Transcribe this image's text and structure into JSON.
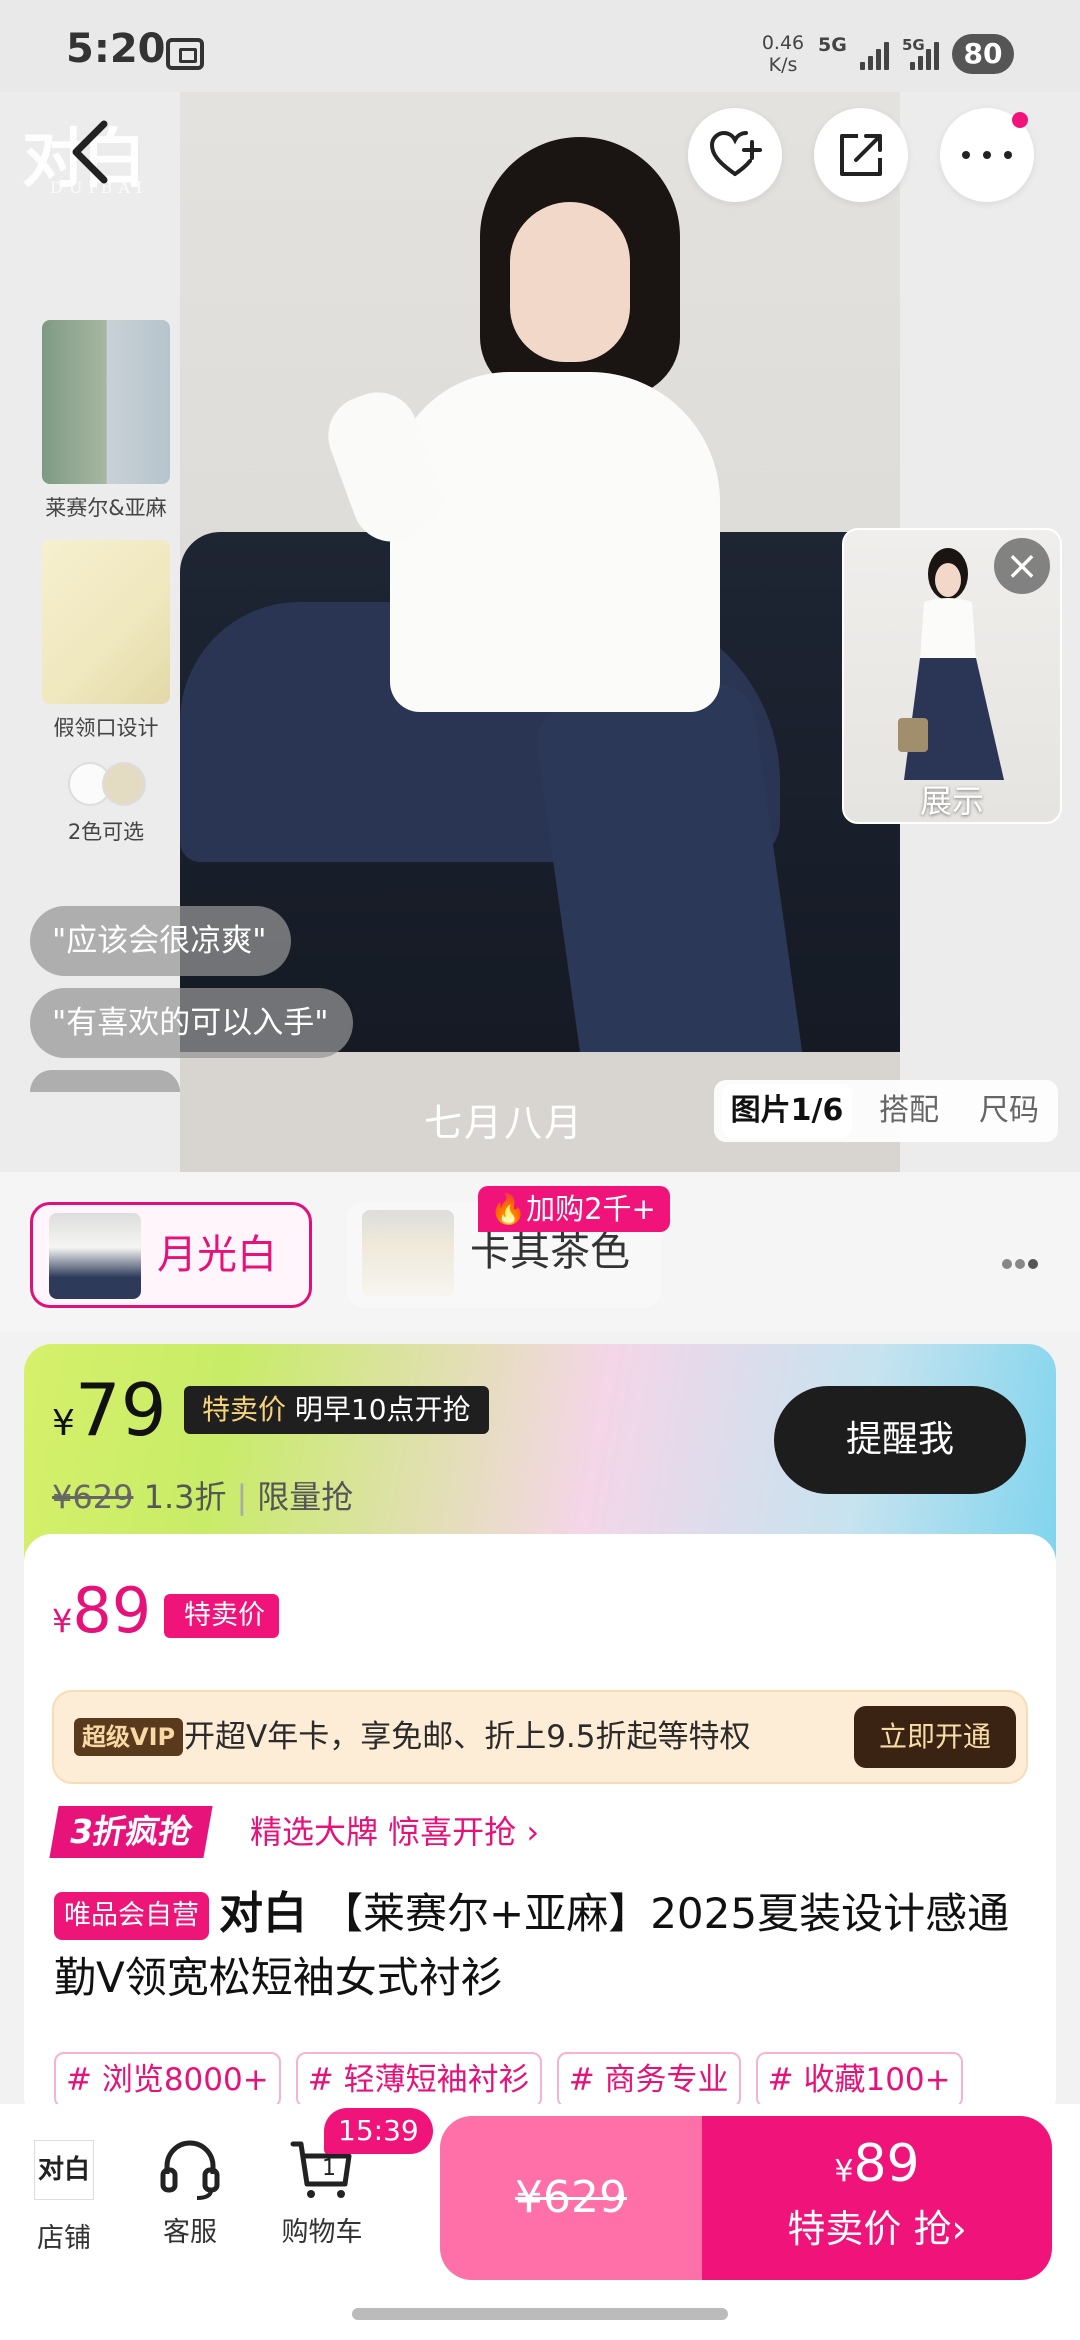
{
  "status_bar": {
    "time": "5:20",
    "speed_value": "0.46",
    "speed_unit": "K/s",
    "net1": "5G",
    "net2": "5G",
    "battery": "80"
  },
  "brand": {
    "logo_text": "对白",
    "logo_sub": "DUIBAI"
  },
  "hero": {
    "caption": "七月八月",
    "features": [
      {
        "label": "莱赛尔&亚麻"
      },
      {
        "label": "假领口设计"
      }
    ],
    "swatch_label": "2色可选",
    "bubbles": [
      "\"应该会很凉爽\"",
      "\"有喜欢的可以入手\""
    ],
    "float_video_label": "展示",
    "image_tabs": [
      "图片1/6",
      "搭配",
      "尺码"
    ]
  },
  "colors": {
    "options": [
      {
        "name": "月光白",
        "selected": true
      },
      {
        "name": "卡其茶色",
        "selected": false
      }
    ],
    "hot_badge": "加购2千+"
  },
  "promo": {
    "currency": "¥",
    "price": "79",
    "tag_label": "特卖价",
    "tag_time": "明早10点开抢",
    "original_price": "¥629",
    "discount": "1.3折",
    "limit": "限量抢",
    "remind_label": "提醒我"
  },
  "current": {
    "currency": "¥",
    "price": "89",
    "tag": "特卖价"
  },
  "vip": {
    "badge": "超级VIP",
    "text": "开超V年卡，享免邮、折上9.5折起等特权",
    "button": "立即开通"
  },
  "deal": {
    "badge": "3折疯抢",
    "text": "精选大牌 惊喜开抢 ›"
  },
  "product": {
    "self_badge": "唯品会自营",
    "brand": "对白",
    "title": "【莱赛尔+亚麻】2025夏装设计感通勤V领宽松短袖女式衬衫"
  },
  "tags": [
    "# 浏览8000+",
    "# 轻薄短袖衬衫",
    "# 商务专业",
    "# 收藏100+"
  ],
  "bottom": {
    "shop_label": "店铺",
    "shop_logo": "对白",
    "service_label": "客服",
    "cart_label": "购物车",
    "cart_count": "1",
    "timer": "15:39",
    "orig_price": "¥629",
    "buy_currency": "¥",
    "buy_price": "89",
    "buy_label": "特卖价 抢›"
  },
  "colors_theme": {
    "accent": "#f0137a",
    "dark": "#1d1d1d"
  }
}
